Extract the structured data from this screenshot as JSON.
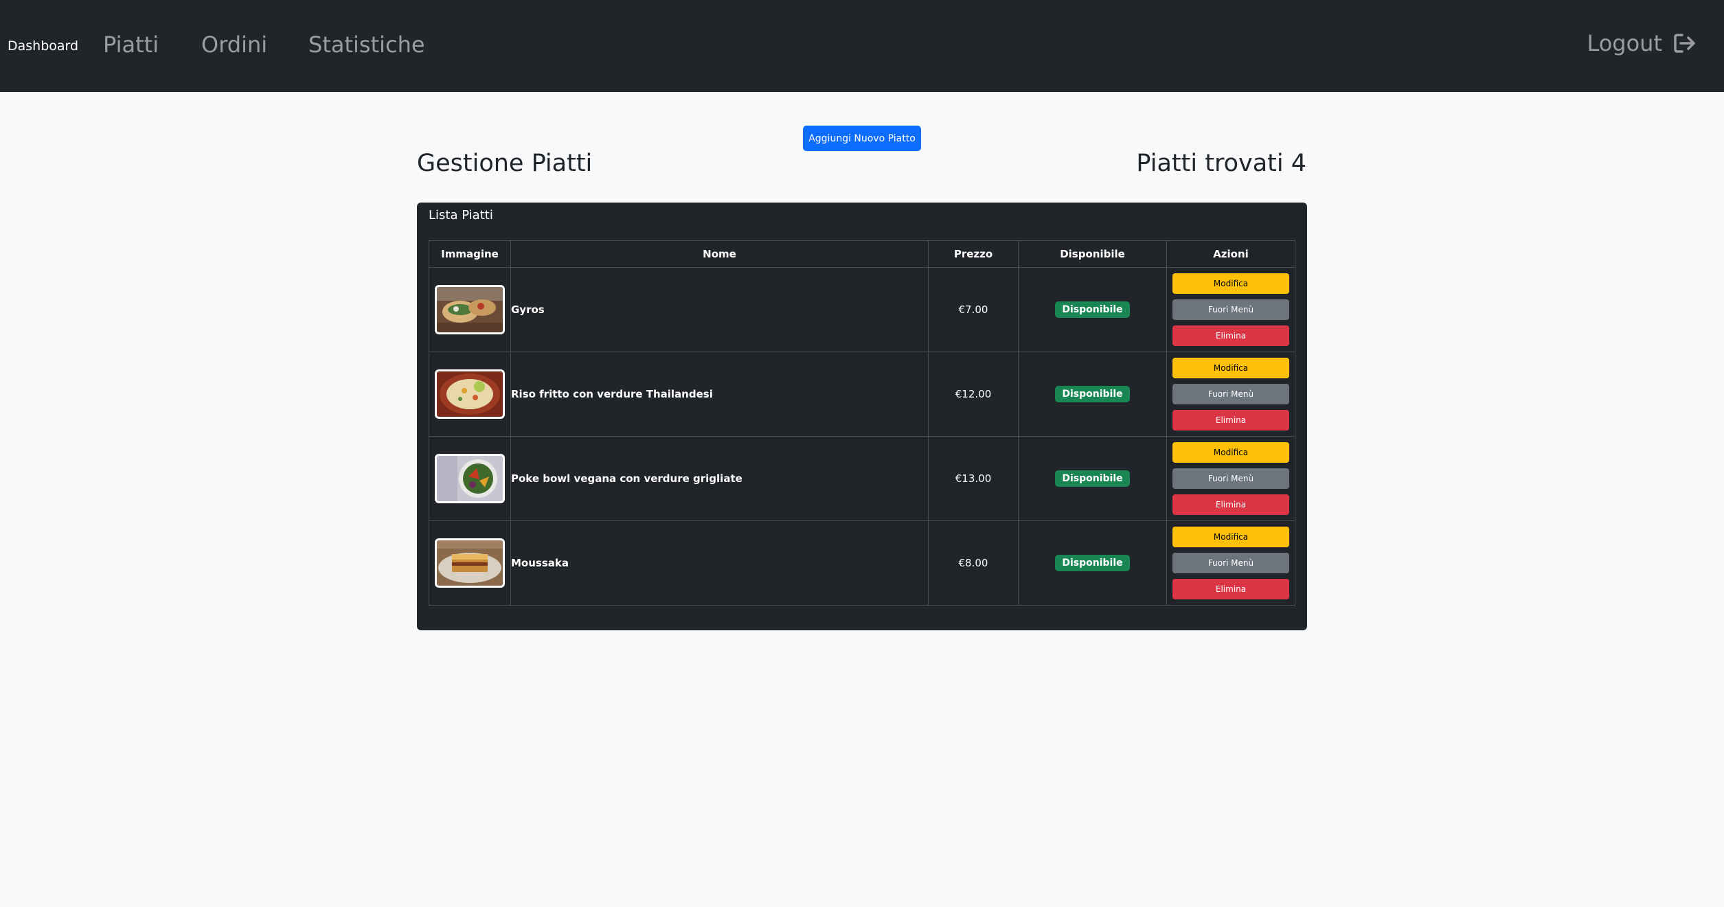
{
  "navbar": {
    "brand": "Dashboard",
    "links": [
      "Piatti",
      "Ordini",
      "Statistiche"
    ],
    "logout": "Logout"
  },
  "main": {
    "add_button": "Aggiungi Nuovo Piatto",
    "title": "Gestione Piatti",
    "count_label": "Piatti trovati 4"
  },
  "card": {
    "header": "Lista Piatti",
    "columns": [
      "Immagine",
      "Nome",
      "Prezzo",
      "Disponibile",
      "Azioni"
    ],
    "rows": [
      {
        "name": "Gyros",
        "price": "€7.00",
        "status": "Disponibile",
        "image_icon": "gyros-photo-icon"
      },
      {
        "name": "Riso fritto con verdure Thailandesi",
        "price": "€12.00",
        "status": "Disponibile",
        "image_icon": "fried-rice-photo-icon"
      },
      {
        "name": "Poke bowl vegana con verdure grigliate",
        "price": "€13.00",
        "status": "Disponibile",
        "image_icon": "poke-bowl-photo-icon"
      },
      {
        "name": "Moussaka",
        "price": "€8.00",
        "status": "Disponibile",
        "image_icon": "moussaka-photo-icon"
      }
    ],
    "actions": {
      "edit": "Modifica",
      "off_menu": "Fuori Menù",
      "delete": "Elimina"
    }
  },
  "colors": {
    "navbar": "#212529",
    "primary": "#0d6efd",
    "success": "#198754",
    "warning": "#ffc107",
    "secondary": "#6c757d",
    "danger": "#dc3545"
  }
}
